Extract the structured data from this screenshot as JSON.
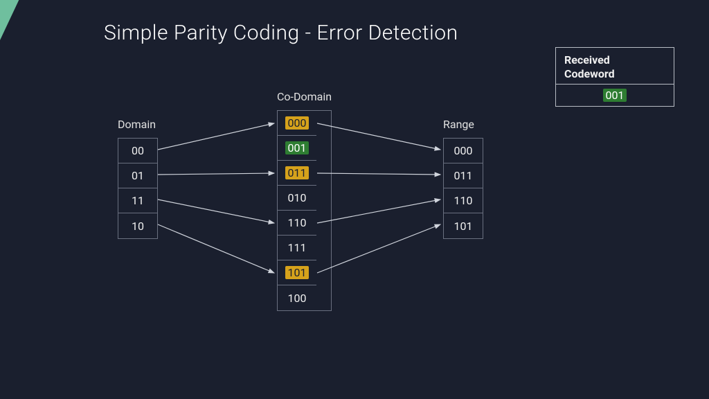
{
  "title": "Simple Parity Coding - Error Detection",
  "domain": {
    "label": "Domain",
    "items": [
      "00",
      "01",
      "11",
      "10"
    ]
  },
  "codomain": {
    "label": "Co-Domain",
    "items": [
      {
        "value": "000",
        "highlight": "yellow"
      },
      {
        "value": "001",
        "highlight": "green"
      },
      {
        "value": "011",
        "highlight": "yellow"
      },
      {
        "value": "010",
        "highlight": null
      },
      {
        "value": "110",
        "highlight": null
      },
      {
        "value": "111",
        "highlight": null
      },
      {
        "value": "101",
        "highlight": "yellow"
      },
      {
        "value": "100",
        "highlight": null
      }
    ]
  },
  "range": {
    "label": "Range",
    "items": [
      "000",
      "011",
      "110",
      "101"
    ]
  },
  "received": {
    "label_line1": "Received",
    "label_line2": "Codeword",
    "value": "001",
    "highlight": "green"
  },
  "mappings_domain_to_codomain": [
    {
      "from": "00",
      "to": "000"
    },
    {
      "from": "01",
      "to": "011"
    },
    {
      "from": "11",
      "to": "110"
    },
    {
      "from": "10",
      "to": "101"
    }
  ],
  "mappings_codomain_to_range": [
    {
      "from": "000",
      "to": "000"
    },
    {
      "from": "011",
      "to": "011"
    },
    {
      "from": "110",
      "to": "110"
    },
    {
      "from": "101",
      "to": "101"
    }
  ],
  "colors": {
    "background": "#1a1f2e",
    "accent_blue": "#1251a3",
    "accent_green": "#6fbf9e",
    "highlight_yellow": "#d6a21b",
    "highlight_green": "#2e7d32",
    "border": "#6a7080"
  }
}
